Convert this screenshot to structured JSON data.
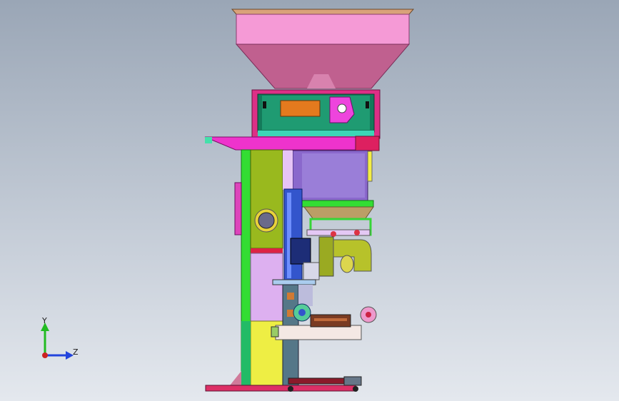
{
  "viewport": {
    "background_top": "#9aa6b6",
    "background_bottom": "#e4e8ee"
  },
  "triad": {
    "y_label": "Y",
    "z_label": "Z",
    "y_color": "#22bb22",
    "z_color": "#2244dd",
    "x_color": "#cc2222"
  },
  "colors": {
    "hopper": "#f28ad0",
    "hopper_shadow": "#b8568e",
    "frame_green": "#33dd33",
    "frame_olive": "#99bb22",
    "frame_pink": "#ee33bb",
    "panel_purple": "#8866cc",
    "panel_lilac": "#ccaaee",
    "accent_red": "#dd2244",
    "accent_teal": "#22aa99",
    "accent_blue": "#3355cc",
    "accent_yellow": "#eeee44",
    "accent_orange": "#dd7722"
  }
}
